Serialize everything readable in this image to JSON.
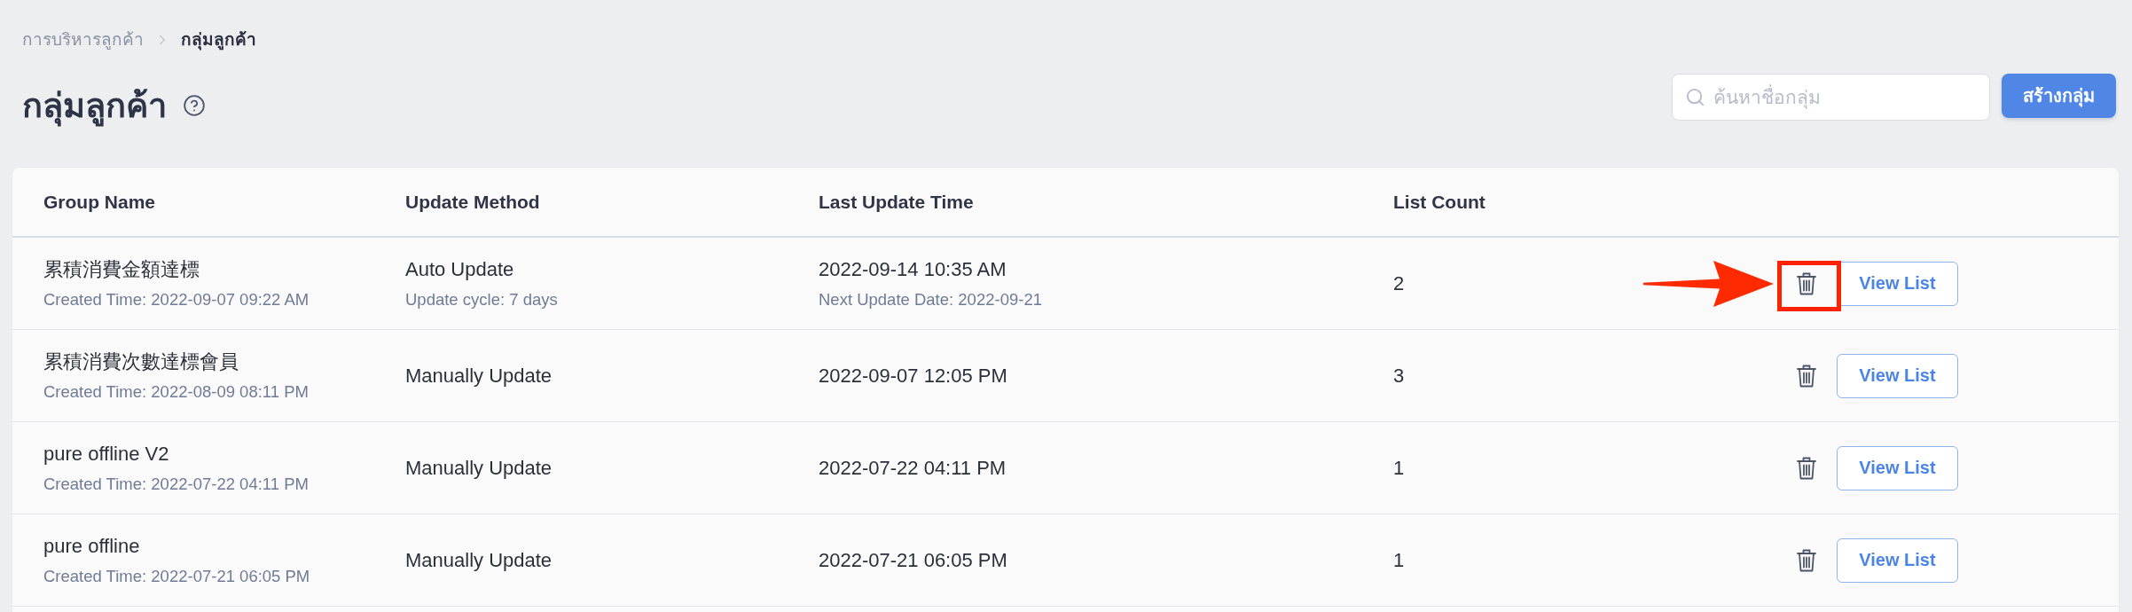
{
  "breadcrumb": [
    {
      "label": "การบริหารลูกค้า",
      "current": false
    },
    {
      "label": "กลุ่มลูกค้า",
      "current": true
    }
  ],
  "page_title": "กลุ่มลูกค้า",
  "search": {
    "placeholder": "ค้นหาชื่อกลุ่ม"
  },
  "create_button": "สร้างกลุ่ม",
  "table": {
    "columns": [
      "Group Name",
      "Update Method",
      "Last Update Time",
      "List Count"
    ],
    "rows": [
      {
        "name": "累積消費金額達標",
        "created": "Created Time: 2022-09-07 09:22 AM",
        "method": "Auto Update",
        "method_detail": "Update cycle: 7 days",
        "last_update": "2022-09-14 10:35 AM",
        "next_update": "Next Update Date: 2022-09-21",
        "count": "2",
        "action": "View List",
        "highlighted": true
      },
      {
        "name": "累積消費次數達標會員",
        "created": "Created Time: 2022-08-09 08:11 PM",
        "method": "Manually Update",
        "last_update": "2022-09-07 12:05 PM",
        "count": "3",
        "action": "View List",
        "highlighted": false
      },
      {
        "name": "pure offline V2",
        "created": "Created Time: 2022-07-22 04:11 PM",
        "method": "Manually Update",
        "last_update": "2022-07-22 04:11 PM",
        "count": "1",
        "action": "View List",
        "highlighted": false
      },
      {
        "name": "pure offline",
        "created": "Created Time: 2022-07-21 06:05 PM",
        "method": "Manually Update",
        "last_update": "2022-07-21 06:05 PM",
        "count": "1",
        "action": "View List",
        "highlighted": false
      }
    ]
  }
}
